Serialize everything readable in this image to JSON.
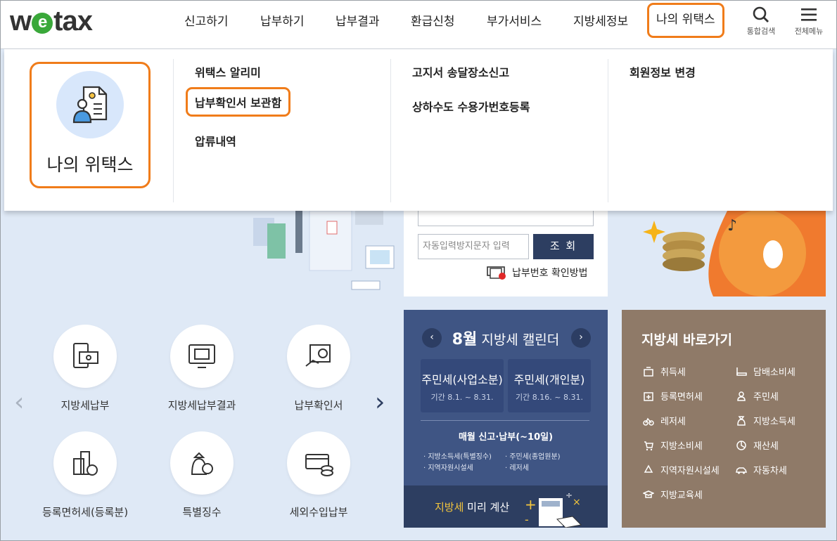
{
  "header": {
    "logo_text": "wetax",
    "nav": [
      "신고하기",
      "납부하기",
      "납부결과",
      "환급신청",
      "부가서비스",
      "지방세정보",
      "나의 위택스"
    ],
    "search_label": "통합검색",
    "allmenu_label": "전체메뉴"
  },
  "mega_menu": {
    "feature_title": "나의 위택스",
    "col1": [
      "위택스 알리미",
      "납부확인서 보관함",
      "압류내역"
    ],
    "col2": [
      "고지서 송달장소신고",
      "상하수도 수용가번호등록"
    ],
    "col3": [
      "회원정보 변경"
    ]
  },
  "services": {
    "row1": [
      "지방세납부",
      "지방세납부결과",
      "납부확인서"
    ],
    "row2": [
      "등록면허세(등록분)",
      "특별징수",
      "세외수입납부"
    ]
  },
  "lookup": {
    "captcha_placeholder": "자동입력방지문자 입력",
    "lookup_button": "조 회",
    "confirm_link": "납부번호 확인방법"
  },
  "calendar": {
    "month": "8월",
    "title_suffix": "지방세 캘린더",
    "items": [
      {
        "name": "주민세(사업소분)",
        "period": "기간 8.1. ~ 8.31."
      },
      {
        "name": "주민세(개인분)",
        "period": "기간 8.16. ~ 8.31."
      }
    ],
    "monthly_title": "매월 신고·납부(~10일)",
    "monthly_items": [
      "· 지방소득세(특별징수)",
      "· 주민세(종업원분)",
      "· 지역자원시설세",
      "· 레저세"
    ],
    "calc_highlight": "지방세",
    "calc_rest": " 미리 계산"
  },
  "quick_links": {
    "title": "지방세 바로가기",
    "left": [
      "취득세",
      "등록면허세",
      "레저세",
      "지방소비세",
      "지역자원시설세",
      "지방교육세"
    ],
    "right": [
      "담배소비세",
      "주민세",
      "지방소득세",
      "재산세",
      "자동차세"
    ]
  },
  "colors": {
    "highlight": "#f07c1a",
    "navy": "#2d3e61",
    "calendar_bg": "#3f5584",
    "quick_bg": "#8f7a68",
    "page_bg": "#dfe9f6"
  }
}
